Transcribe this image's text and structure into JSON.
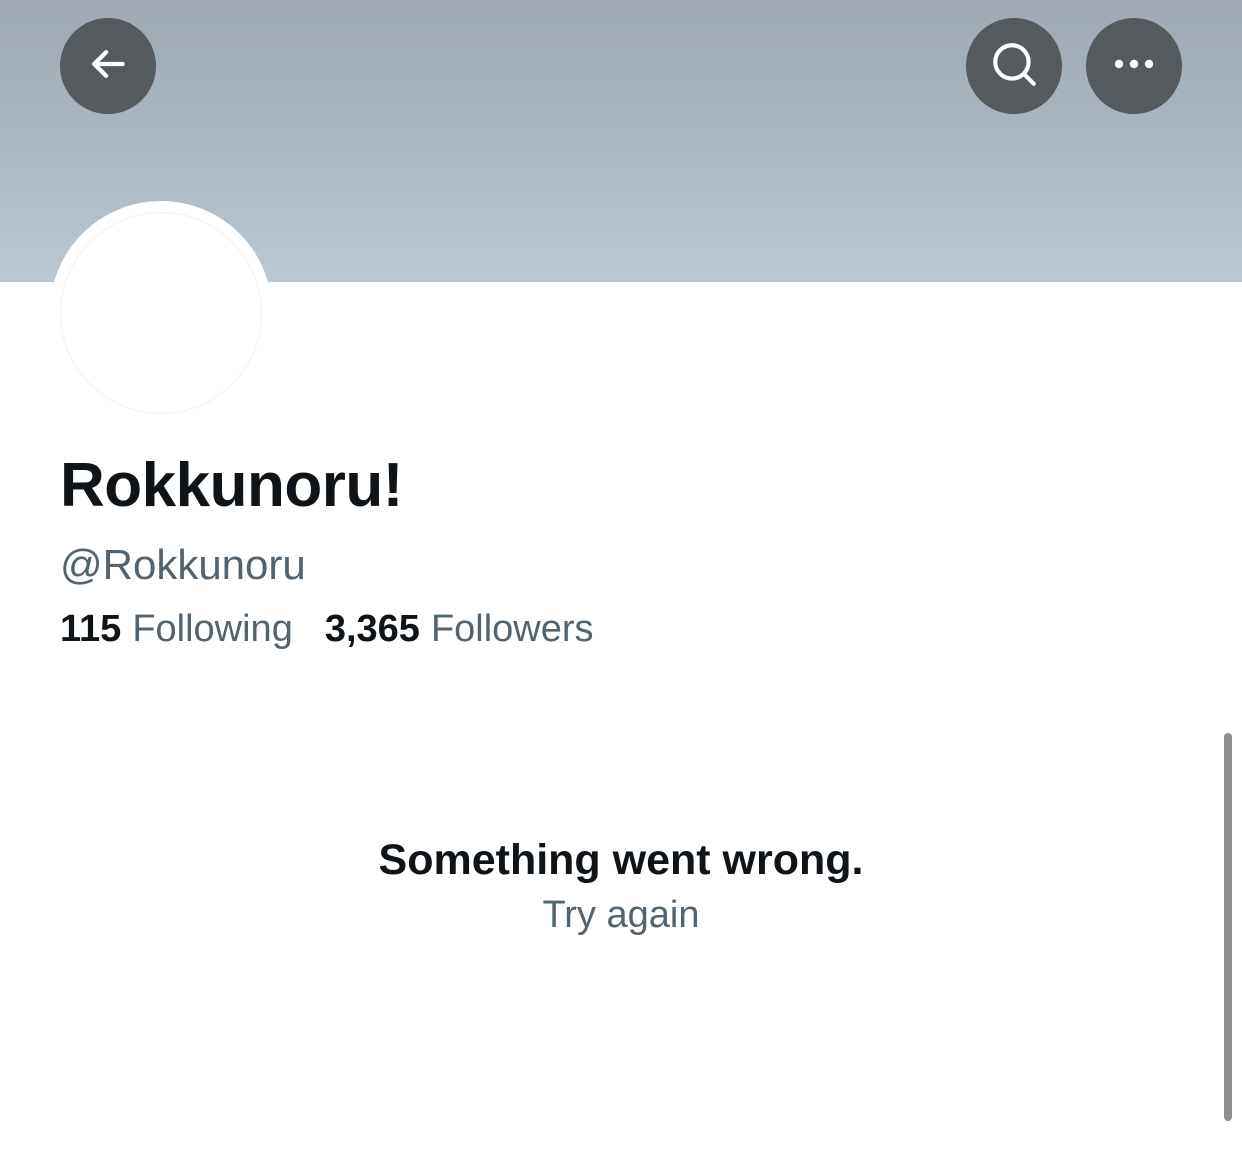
{
  "header": {
    "back_icon": "arrow-left-icon",
    "search_icon": "search-icon",
    "more_icon": "more-horizontal-icon",
    "icon_button_color": "#555a5f"
  },
  "profile": {
    "display_name": "Rokkunoru!",
    "handle": "@Rokkunoru",
    "following_count": "115",
    "following_label": "Following",
    "followers_count": "3,365",
    "followers_label": "Followers"
  },
  "error": {
    "title": "Something went wrong.",
    "retry_label": "Try again"
  },
  "colors": {
    "primary_text": "#0f1419",
    "secondary_text": "#536471"
  }
}
